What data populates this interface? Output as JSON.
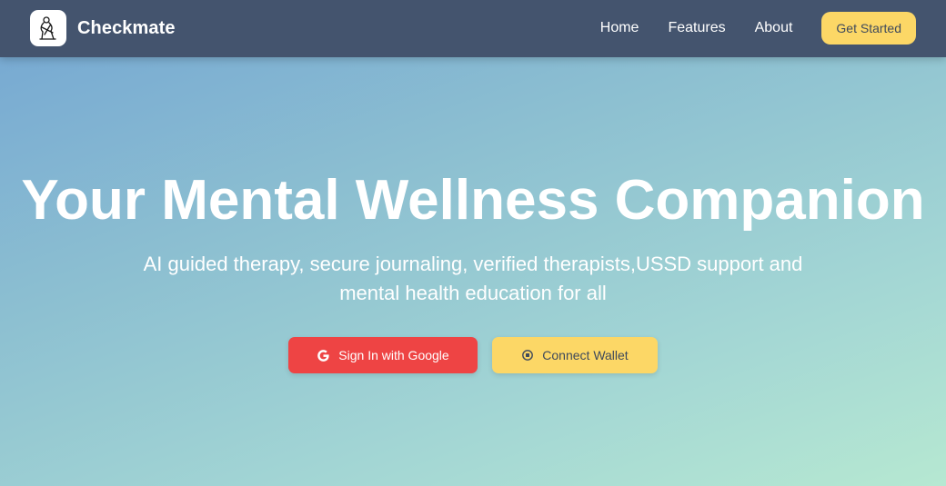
{
  "navbar": {
    "brand_name": "Checkmate",
    "logo_icon": "person-logo-icon",
    "links": [
      {
        "label": "Home"
      },
      {
        "label": "Features"
      },
      {
        "label": "About"
      }
    ],
    "cta_label": "Get Started"
  },
  "hero": {
    "title": "Your Mental Wellness Companion",
    "subtitle": "AI guided therapy, secure journaling, verified therapists,USSD support and mental health education for all",
    "google_button_label": "Sign In with Google",
    "google_icon": "google-icon",
    "wallet_button_label": "Connect Wallet",
    "wallet_icon": "wallet-icon"
  },
  "colors": {
    "navbar_bg": "#44546e",
    "accent_yellow": "#fcd766",
    "google_red": "#ee4444",
    "gradient_start": "#78aad2",
    "gradient_end": "#b6e8d2"
  }
}
